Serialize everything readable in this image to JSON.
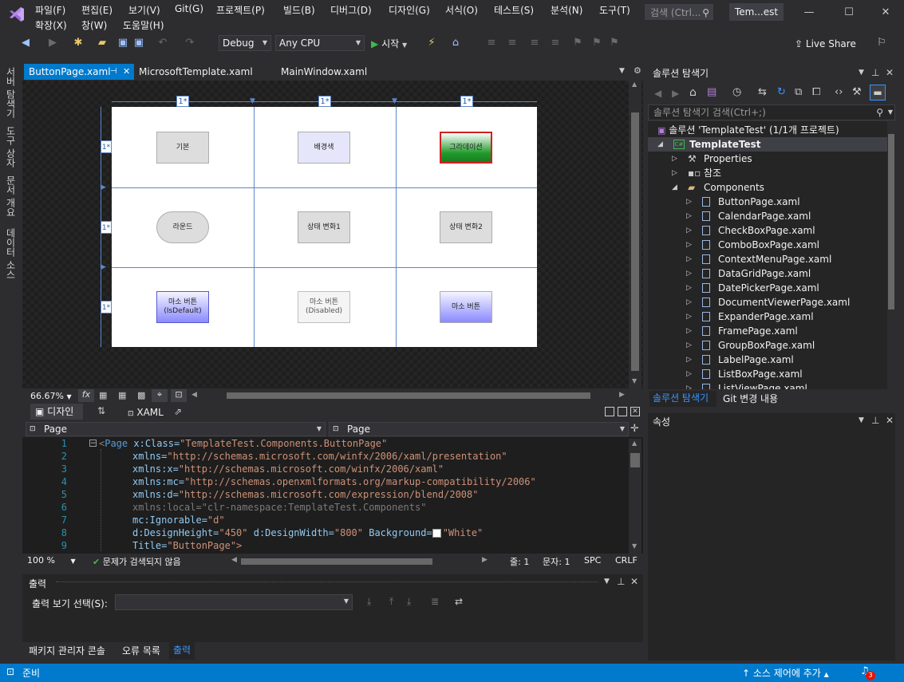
{
  "menu": {
    "row1": [
      "파일(F)",
      "편집(E)",
      "보기(V)",
      "Git(G)",
      "프로젝트(P)",
      "빌드(B)",
      "디버그(D)",
      "디자인(G)",
      "서식(O)",
      "테스트(S)",
      "분석(N)",
      "도구(T)"
    ],
    "row2": [
      "확장(X)",
      "창(W)",
      "도움말(H)"
    ],
    "search_placeholder": "검색 (Ctrl...",
    "solution_short": "Tem...est"
  },
  "toolbar": {
    "config": "Debug",
    "platform": "Any CPU",
    "start_label": "시작",
    "live_share": "Live Share"
  },
  "left_tabs": [
    "서버 탐색기",
    "도구 상자",
    "문서 개요",
    "데이터 소스"
  ],
  "doc_tabs": [
    {
      "label": "ButtonPage.xaml",
      "active": true
    },
    {
      "label": "MicrosoftTemplate.xaml",
      "active": false
    },
    {
      "label": "MainWindow.xaml",
      "active": false
    }
  ],
  "designer": {
    "col_markers": [
      "1*",
      "1*",
      "1*"
    ],
    "row_markers": [
      "1*",
      "1*",
      "1*"
    ],
    "buttons": {
      "basic": "기본",
      "background": "배경색",
      "gradient": "그라데이션",
      "round": "라운드",
      "state1": "상태 변화1",
      "state2": "상태 변화2",
      "mouse_default_1": "마소 버튼",
      "mouse_default_2": "(IsDefault)",
      "mouse_disabled_1": "마소 버튼",
      "mouse_disabled_2": "(Disabled)",
      "mouse": "마소 버튼"
    },
    "zoom": "66.67%"
  },
  "split": {
    "design_tab": "디자인",
    "xaml_tab": "XAML"
  },
  "selectors": {
    "left": "Page",
    "right": "Page"
  },
  "code": {
    "line_numbers": [
      "1",
      "2",
      "3",
      "4",
      "5",
      "6",
      "7",
      "8",
      "9"
    ],
    "l1_tag": "Page",
    "l1_attr": "x:Class=",
    "l1_val": "\"TemplateTest.Components.ButtonPage\"",
    "l2_attr": "xmlns=",
    "l2_val": "\"http://schemas.microsoft.com/winfx/2006/xaml/presentation\"",
    "l3_attr": "xmlns:x=",
    "l3_val": "\"http://schemas.microsoft.com/winfx/2006/xaml\"",
    "l4_attr": "xmlns:mc=",
    "l4_val": "\"http://schemas.openxmlformats.org/markup-compatibility/2006\"",
    "l5_attr": "xmlns:d=",
    "l5_val": "\"http://schemas.microsoft.com/expression/blend/2008\"",
    "l6_text": "xmlns:local=\"clr-namespace:TemplateTest.Components\"",
    "l7_attr": "mc:Ignorable=",
    "l7_val": "\"d\"",
    "l8_attr1": "d:DesignHeight=",
    "l8_val1": "\"450\"",
    "l8_attr2": " d:DesignWidth=",
    "l8_val2": "\"800\"",
    "l8_attr3": " Background=",
    "l8_val3": "\"White\"",
    "l9_attr": "Title=",
    "l9_val": "\"ButtonPage\">"
  },
  "editor_status": {
    "zoom": "100 %",
    "issues": "문제가 검색되지 않음",
    "line": "줄: 1",
    "char": "문자: 1",
    "spc": "SPC",
    "crlf": "CRLF"
  },
  "output": {
    "title": "출력",
    "source_label": "출력 보기 선택(S):",
    "tabs": [
      "패키지 관리자 콘솔",
      "오류 목록",
      "출력"
    ]
  },
  "solution": {
    "title": "솔루션 탐색기",
    "search": "솔루션 탐색기 검색(Ctrl+;)",
    "root": "솔루션 'TemplateTest' (1/1개 프로젝트)",
    "project": "TemplateTest",
    "properties": "Properties",
    "references": "참조",
    "components": "Components",
    "files": [
      "ButtonPage.xaml",
      "CalendarPage.xaml",
      "CheckBoxPage.xaml",
      "ComboBoxPage.xaml",
      "ContextMenuPage.xaml",
      "DataGridPage.xaml",
      "DatePickerPage.xaml",
      "DocumentViewerPage.xaml",
      "ExpanderPage.xaml",
      "FramePage.xaml",
      "GroupBoxPage.xaml",
      "LabelPage.xaml",
      "ListBoxPage.xaml",
      "ListViewPage.xaml"
    ],
    "bottom_tabs": [
      "솔루션 탐색기",
      "Git 변경 내용"
    ]
  },
  "properties_panel": {
    "title": "속성"
  },
  "status": {
    "ready": "준비",
    "source_control": "소스 제어에 추가",
    "notifications": "3"
  },
  "colors": {
    "accent": "#007acc",
    "gradient_top": "#1f7a1f",
    "gradient_border": "#d22020",
    "mouse_button": "#8080ff"
  }
}
